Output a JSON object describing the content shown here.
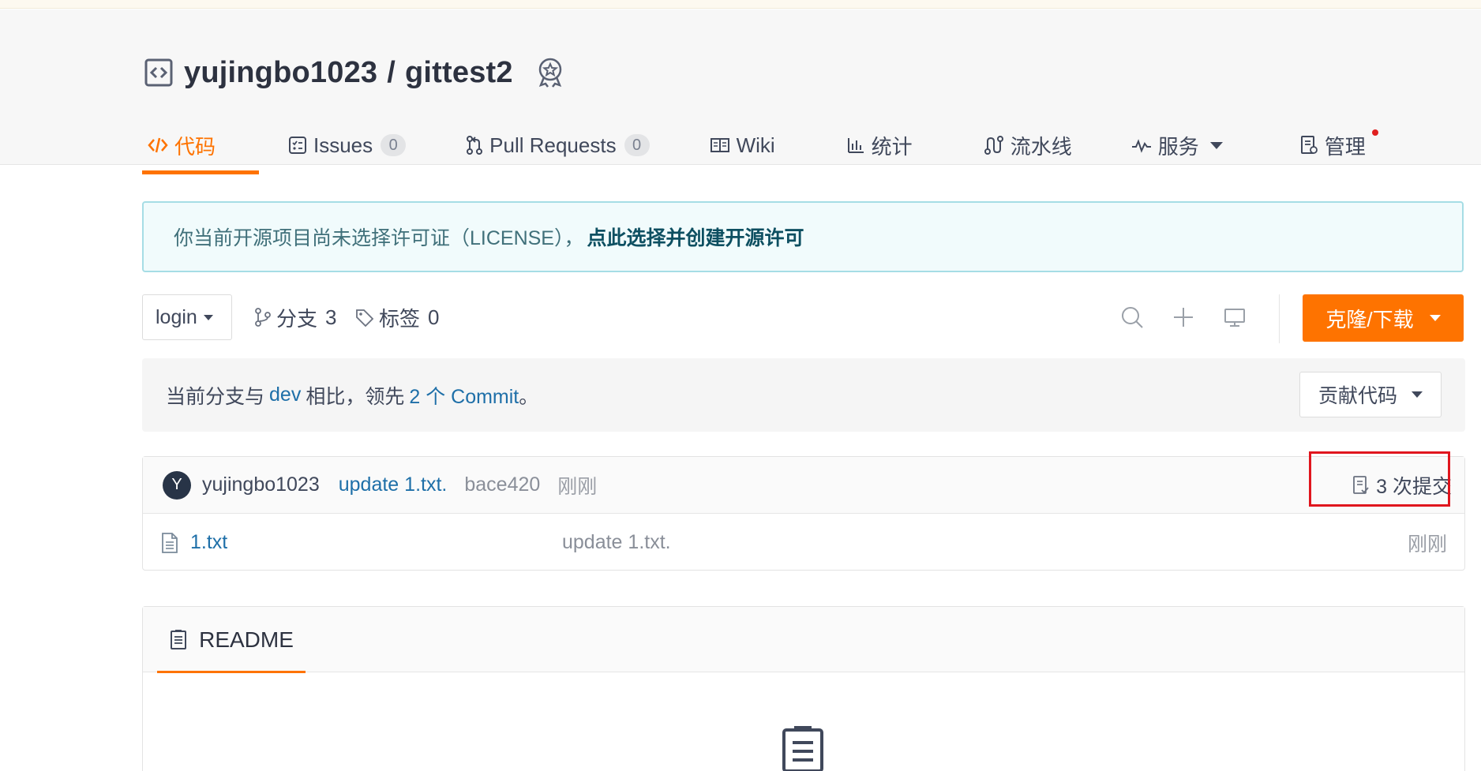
{
  "repo": {
    "owner": "yujingbo1023",
    "separator": "/",
    "name": "gittest2"
  },
  "tabs": [
    {
      "label": "代码",
      "icon": "code-icon",
      "active": true
    },
    {
      "label": "Issues",
      "count": "0",
      "icon": "issues-icon"
    },
    {
      "label": "Pull Requests",
      "count": "0",
      "icon": "pull-request-icon"
    },
    {
      "label": "Wiki",
      "icon": "wiki-book-icon"
    },
    {
      "label": "统计",
      "icon": "bar-chart-icon"
    },
    {
      "label": "流水线",
      "icon": "pipeline-icon"
    },
    {
      "label": "服务",
      "icon": "pulse-icon"
    },
    {
      "label": "管理",
      "icon": "manage-doc-icon"
    }
  ],
  "license_notice": {
    "text": "你当前开源项目尚未选择许可证（LICENSE），",
    "link": "点此选择并创建开源许可"
  },
  "toolbar": {
    "branch": "login",
    "branches_label": "分支",
    "branches_count": "3",
    "tags_label": "标签",
    "tags_count": "0",
    "clone_label": "克隆/下载"
  },
  "compare": {
    "prefix": "当前分支与",
    "base_branch": "dev",
    "middle": "相比，领先",
    "ahead_count": "2 个 Commit",
    "suffix": "。",
    "contribute_label": "贡献代码"
  },
  "latest_commit": {
    "avatar_letter": "Y",
    "author": "yujingbo1023",
    "message": "update 1.txt.",
    "hash": "bace420",
    "time": "刚刚",
    "commits_count_label": "3 次提交"
  },
  "files": [
    {
      "name": "1.txt",
      "message": "update 1.txt.",
      "time": "刚刚"
    }
  ],
  "readme": {
    "tab_label": "README"
  },
  "colors": {
    "accent": "#fe7300",
    "link": "#1e6fa8",
    "highlight": "#e0161e"
  }
}
